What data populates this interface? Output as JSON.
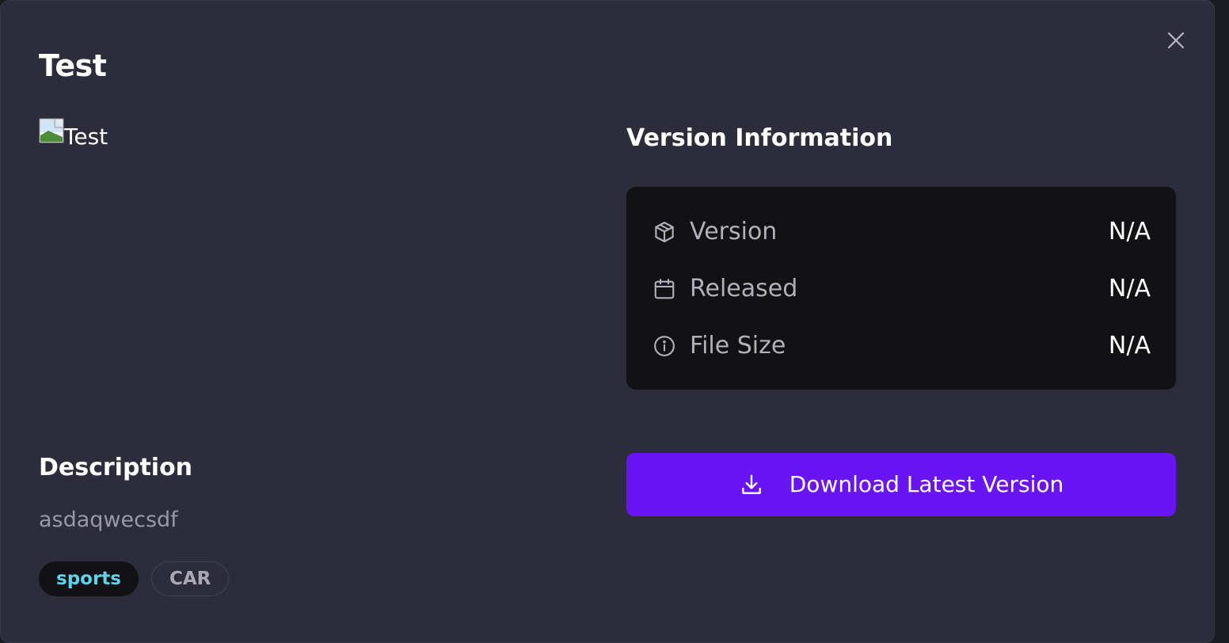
{
  "modal": {
    "title": "Test",
    "close_icon": "close-icon"
  },
  "preview": {
    "alt_text": "Test",
    "icon": "broken-image-icon"
  },
  "version_info": {
    "heading": "Version Information",
    "rows": [
      {
        "icon": "package-icon",
        "label": "Version",
        "value": "N/A"
      },
      {
        "icon": "calendar-icon",
        "label": "Released",
        "value": "N/A"
      },
      {
        "icon": "info-icon",
        "label": "File Size",
        "value": "N/A"
      }
    ]
  },
  "download": {
    "label": "Download Latest Version",
    "icon": "download-icon"
  },
  "description": {
    "heading": "Description",
    "text": "asdaqwecsdf"
  },
  "tags": [
    {
      "label": "sports",
      "active": true
    },
    {
      "label": "CAR",
      "active": false
    }
  ],
  "colors": {
    "modal_bg": "#2d2c3a",
    "card_bg": "#121215",
    "accent": "#6a14f4",
    "tag_active_text": "#5fd3e8",
    "muted_text": "#b1b0bb"
  }
}
